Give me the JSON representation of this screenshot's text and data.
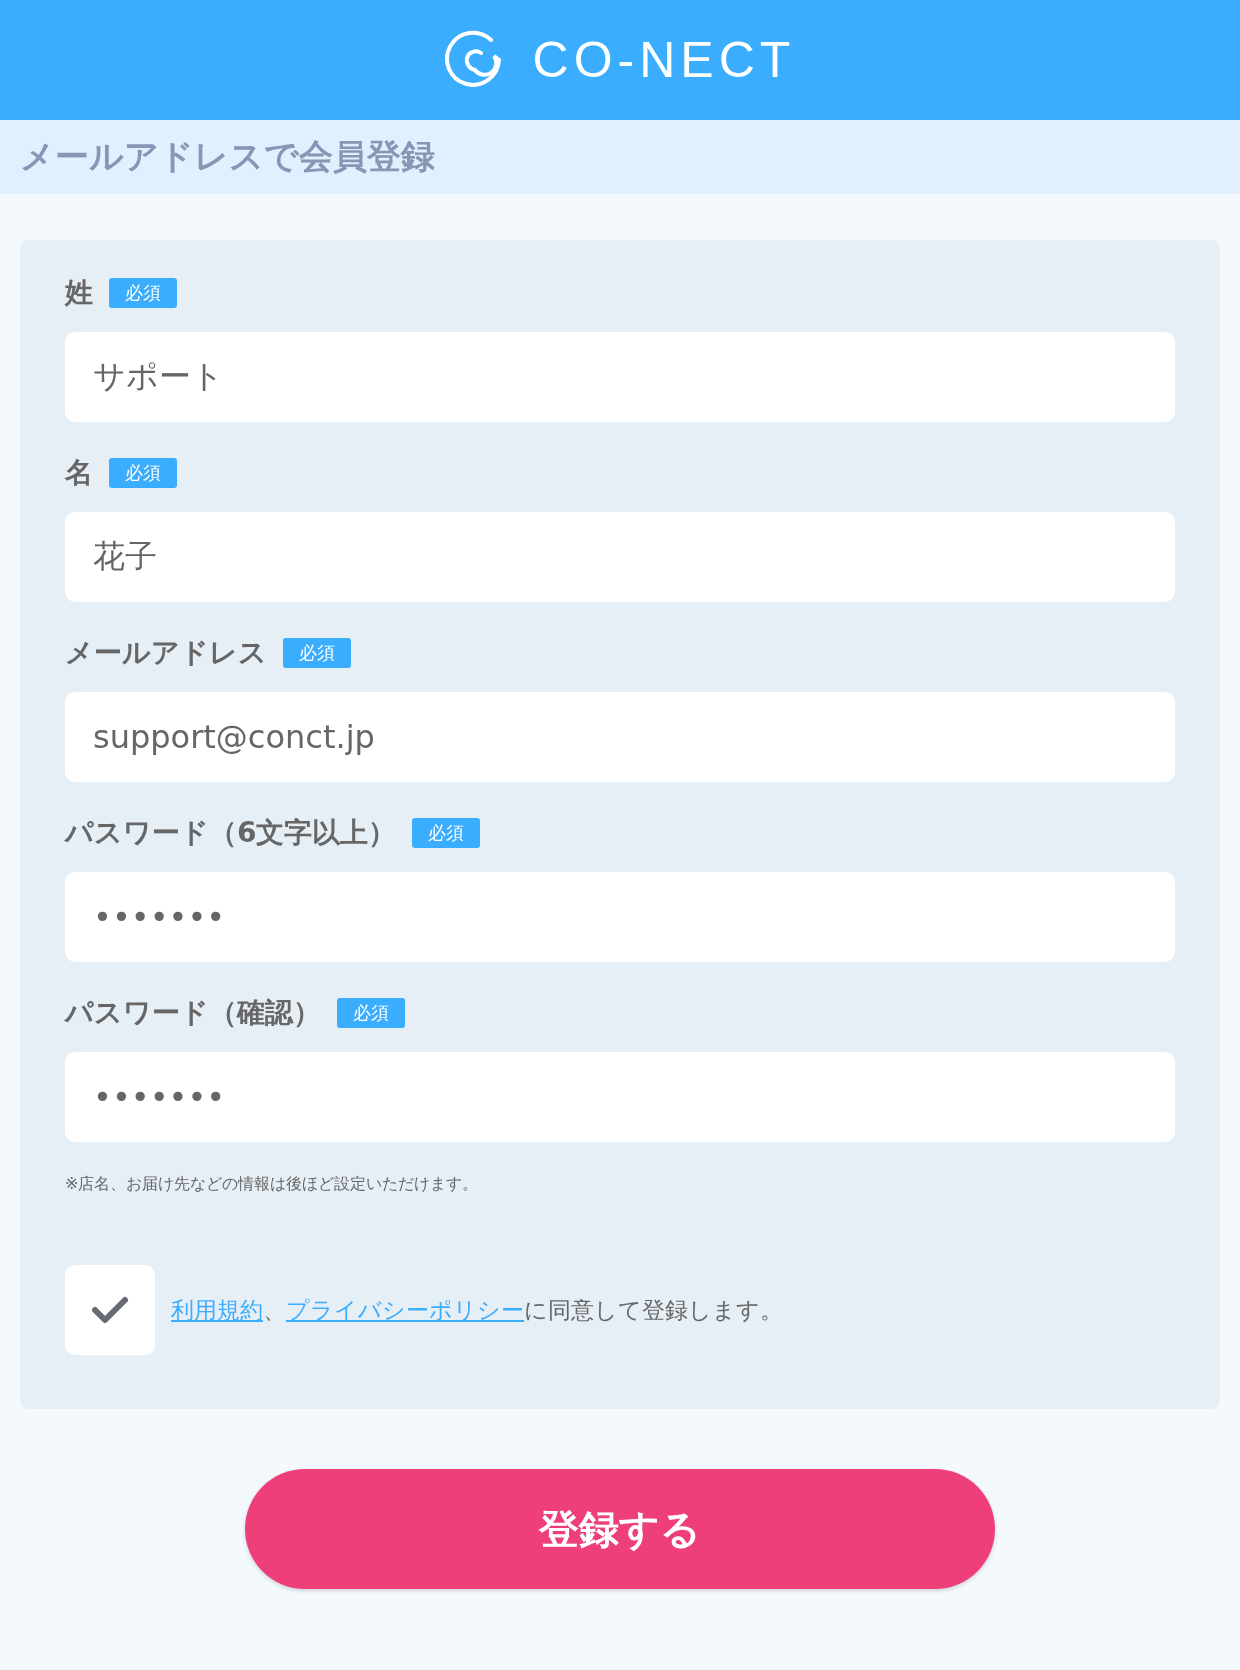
{
  "header": {
    "logo_text": "CO-NECT"
  },
  "page_title": "メールアドレスで会員登録",
  "fields": [
    {
      "label": "姓",
      "badge": "必須",
      "value": "サポート"
    },
    {
      "label": "名",
      "badge": "必須",
      "value": "花子"
    },
    {
      "label": "メールアドレス",
      "badge": "必須",
      "value": "support@conct.jp"
    },
    {
      "label": "パスワード（6文字以上）",
      "badge": "必須",
      "value": "•••••••"
    },
    {
      "label": "パスワード（確認）",
      "badge": "必須",
      "value": "•••••••"
    }
  ],
  "note": "※店名、お届け先などの情報は後ほど設定いただけます。",
  "agreement": {
    "checked": true,
    "parts": [
      {
        "kind": "link",
        "text": "利用規約"
      },
      {
        "kind": "text",
        "text": "、"
      },
      {
        "kind": "link",
        "text": "プライバシーポリシー"
      },
      {
        "kind": "text",
        "text": "に同意して登録します。"
      }
    ]
  },
  "submit_button": "登録する"
}
